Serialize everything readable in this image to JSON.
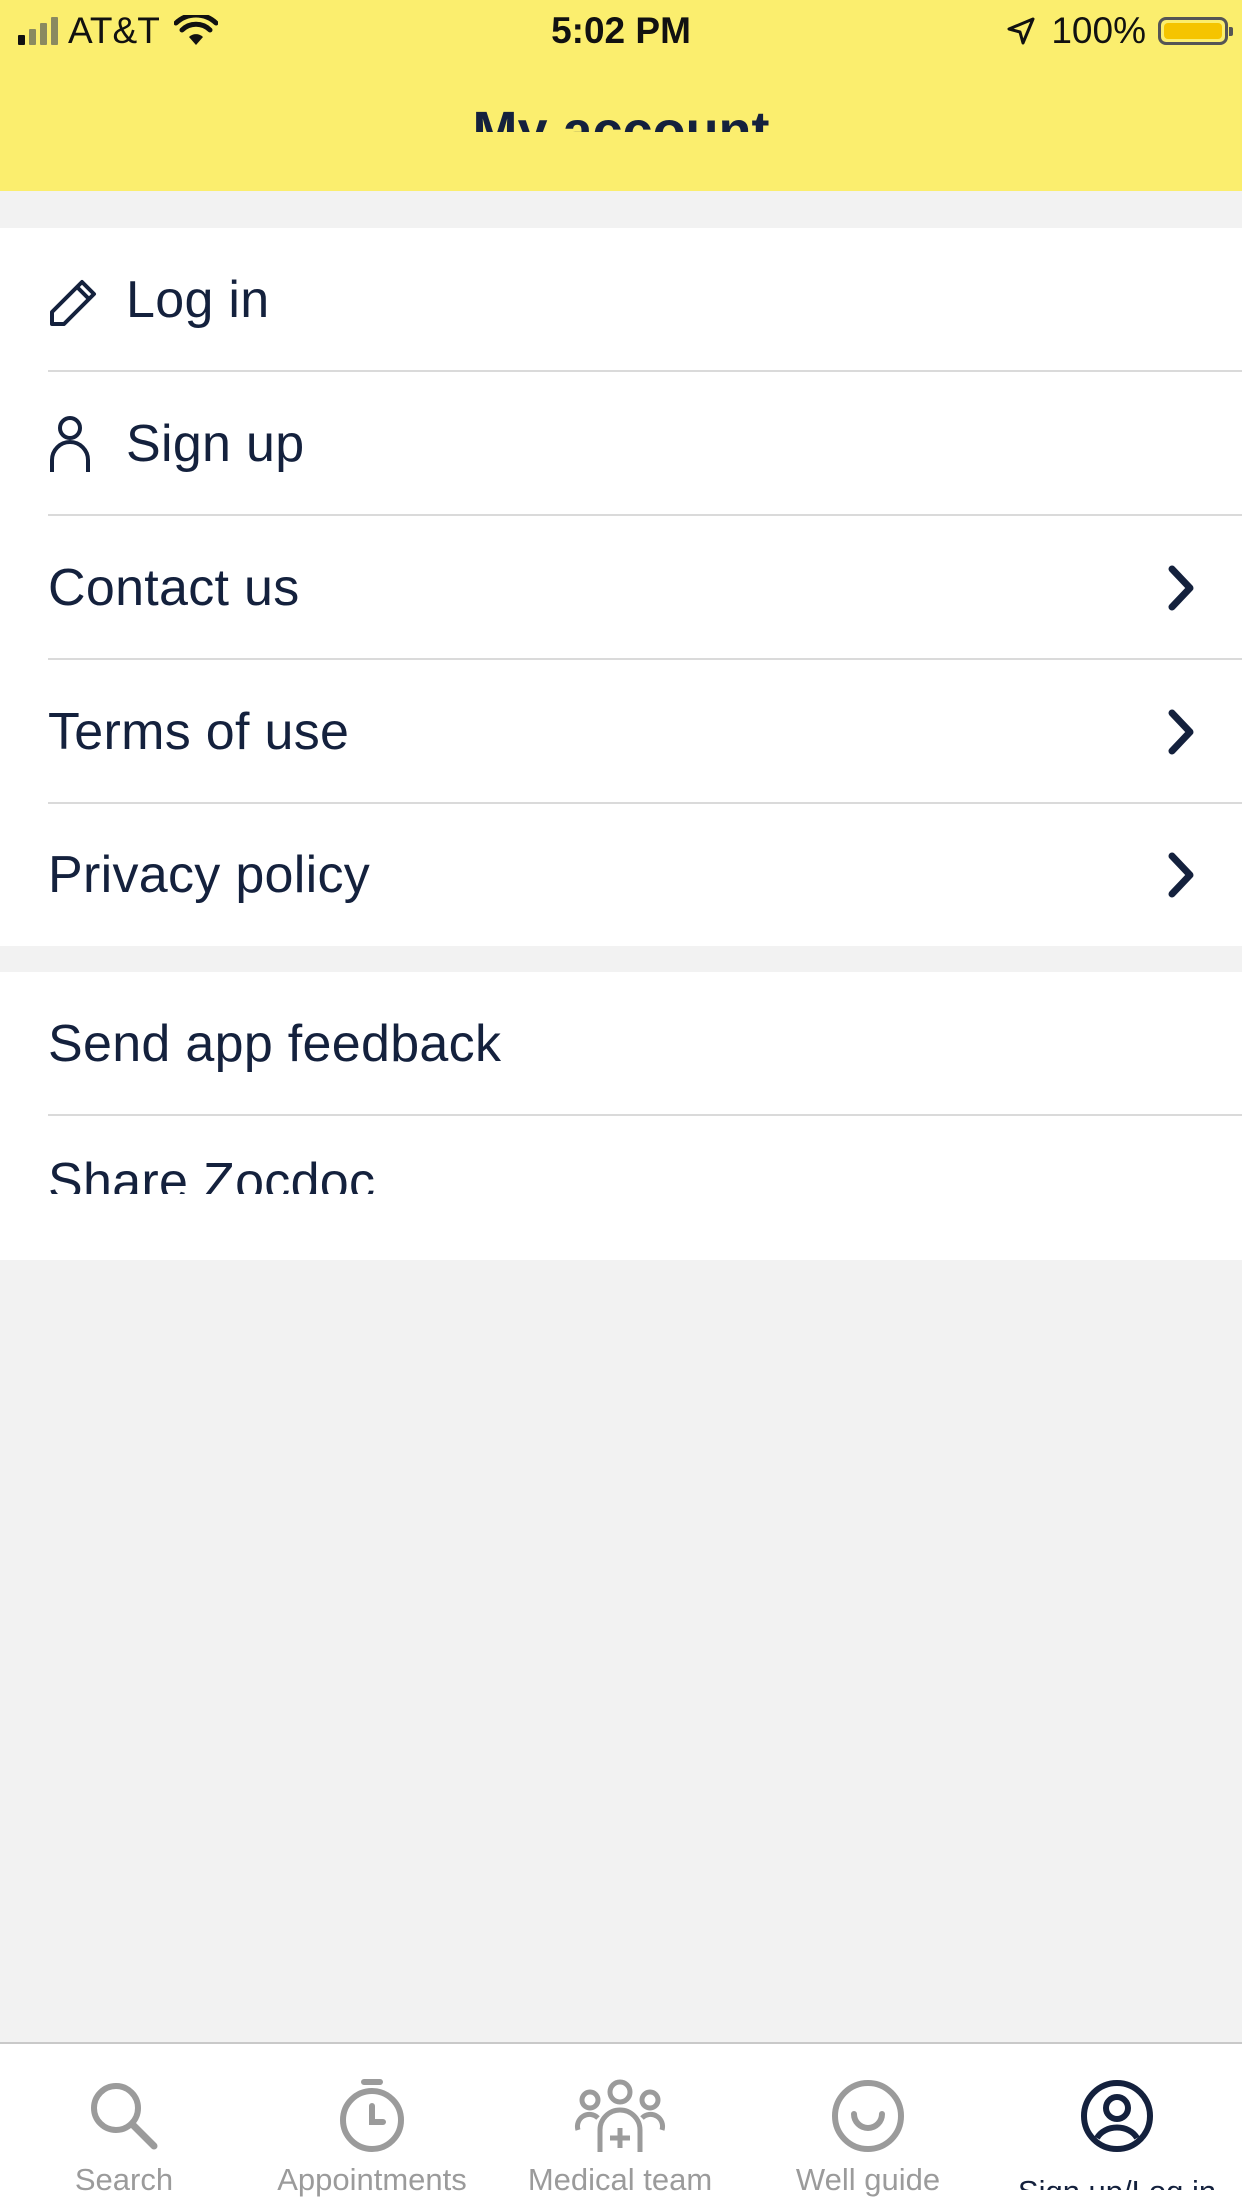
{
  "status_bar": {
    "carrier": "AT&T",
    "time": "5:02 PM",
    "battery": "100%",
    "battery_level": 1.0,
    "icons": [
      "signal-icon",
      "wifi-icon",
      "location-arrow-icon",
      "battery-icon"
    ]
  },
  "header": {
    "title": "My account"
  },
  "menu": {
    "group1": [
      {
        "label": "Log in",
        "icon": "pencil-icon"
      },
      {
        "label": "Sign up",
        "icon": "person-icon"
      },
      {
        "label": "Contact us",
        "icon": "chevron-right-icon"
      },
      {
        "label": "Terms of use",
        "icon": "chevron-right-icon"
      },
      {
        "label": "Privacy policy",
        "icon": "chevron-right-icon"
      }
    ],
    "group2": [
      {
        "label": "Send app feedback"
      },
      {
        "label": "Share Zocdoc"
      }
    ]
  },
  "tabbar": {
    "items": [
      {
        "label": "Search",
        "icon": "search-icon"
      },
      {
        "label": "Appointments",
        "icon": "clock-icon"
      },
      {
        "label": "Medical team",
        "icon": "medical-team-icon"
      },
      {
        "label": "Well guide",
        "icon": "smile-icon"
      },
      {
        "label": "Sign up/Log in",
        "icon": "account-icon",
        "active": true
      }
    ]
  },
  "colors": {
    "header_bg": "#fbee6e",
    "text_primary": "#14213d",
    "tab_inactive": "#9b9b9b",
    "page_bg": "#f2f2f2"
  }
}
